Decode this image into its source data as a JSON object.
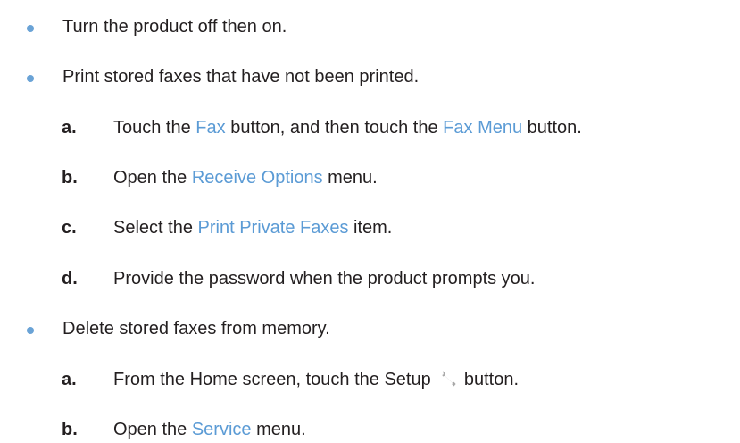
{
  "items": [
    {
      "text": "Turn the product off then on."
    },
    {
      "text": "Print stored faxes that have not been printed.",
      "steps": [
        {
          "letter": "a.",
          "parts": [
            "Touch the ",
            "Fax",
            " button, and then touch the ",
            "Fax Menu",
            " button."
          ]
        },
        {
          "letter": "b.",
          "parts": [
            "Open the ",
            "Receive Options",
            " menu."
          ]
        },
        {
          "letter": "c.",
          "parts": [
            "Select the ",
            "Print Private Faxes",
            " item."
          ]
        },
        {
          "letter": "d.",
          "parts": [
            "Provide the password when the product prompts you."
          ]
        }
      ]
    },
    {
      "text": "Delete stored faxes from memory.",
      "steps": [
        {
          "letter": "a.",
          "parts": [
            "From the Home screen, touch the Setup ",
            "",
            " button."
          ]
        },
        {
          "letter": "b.",
          "parts": [
            "Open the ",
            "Service",
            " menu."
          ]
        }
      ]
    }
  ],
  "icons": {
    "setup": "wrench-icon"
  },
  "colors": {
    "link": "#5b9bd5",
    "bullet": "#6aa3d6",
    "text": "#231f20"
  }
}
